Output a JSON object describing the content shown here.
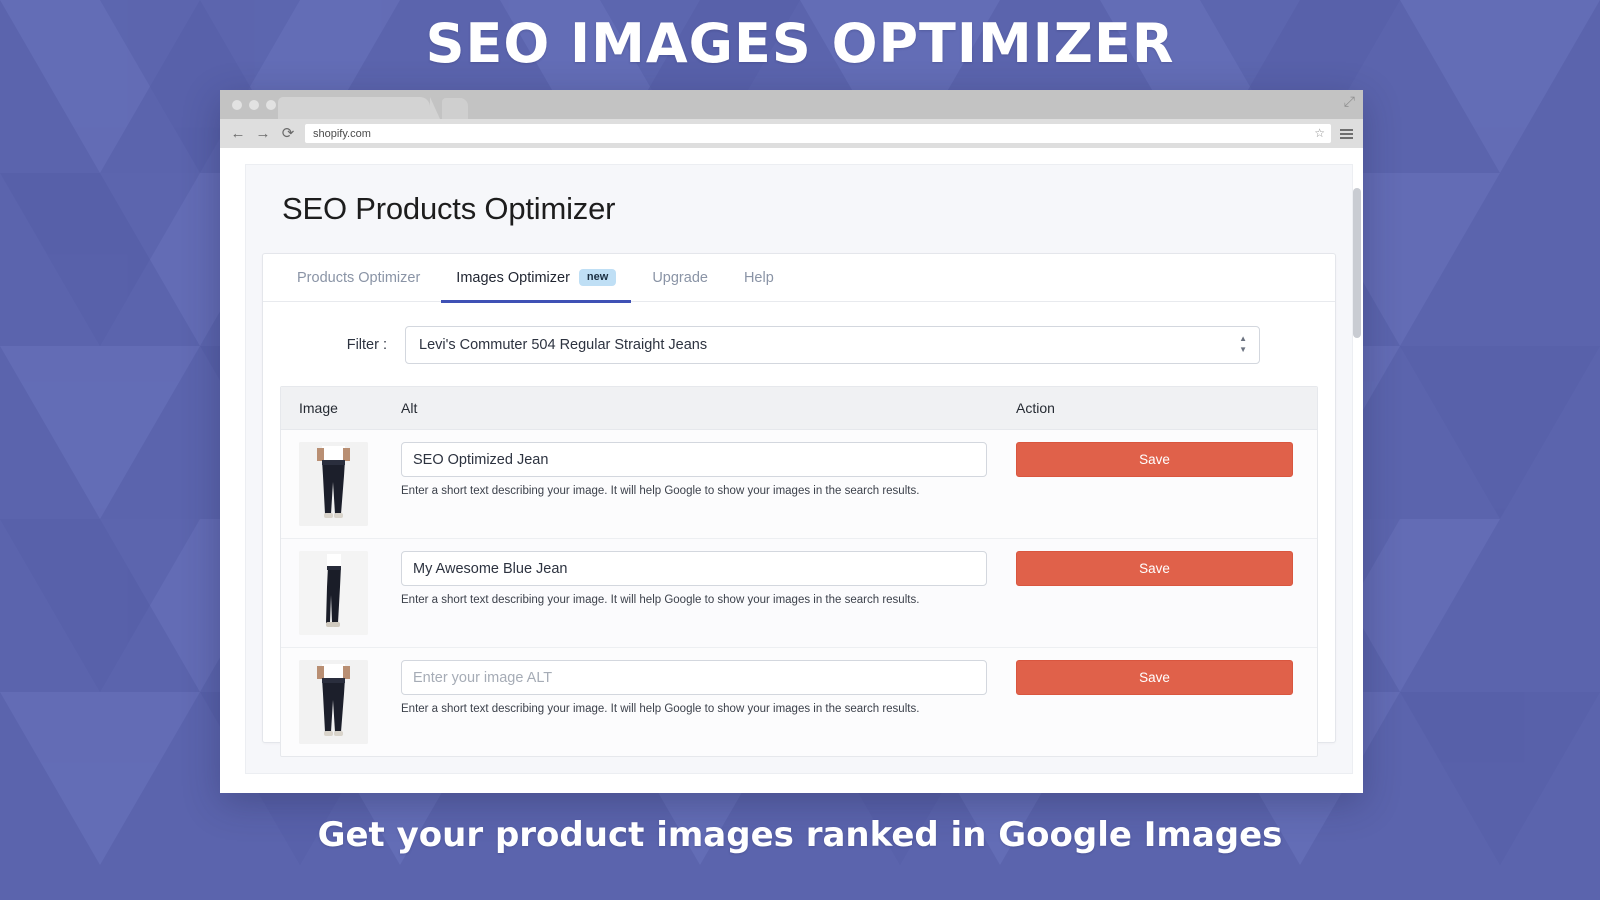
{
  "banner": {
    "headline": "SEO IMAGES OPTIMIZER",
    "footline": "Get your product images ranked in Google Images",
    "background_color": "#5b64ad",
    "background_accent": "#6a74bd"
  },
  "browser": {
    "back_icon": "←",
    "forward_icon": "→",
    "reload_icon": "⟳",
    "url": "shopify.com",
    "star_icon": "☆",
    "menu_icon": "hamburger-icon",
    "resize_icon": "⤢",
    "traffic_lights": [
      "close",
      "minimize",
      "maximize"
    ]
  },
  "app": {
    "title": "SEO Products Optimizer",
    "tabs": [
      {
        "label": "Products Optimizer",
        "active": false,
        "badge": null
      },
      {
        "label": "Images Optimizer",
        "active": true,
        "badge": "new"
      },
      {
        "label": "Upgrade",
        "active": false,
        "badge": null
      },
      {
        "label": "Help",
        "active": false,
        "badge": null
      }
    ],
    "filter": {
      "label": "Filter :",
      "value": "Levi's Commuter 504 Regular Straight Jeans",
      "stepper_up": "▲",
      "stepper_down": "▼"
    },
    "table": {
      "headers": {
        "image": "Image",
        "alt": "Alt",
        "action": "Action"
      },
      "helper_text": "Enter a short text describing your image. It will help Google to show your images in the search results.",
      "save_label": "Save",
      "save_color": "#e0614a",
      "alt_placeholder": "Enter your image ALT",
      "rows": [
        {
          "alt_value": "SEO Optimized Jean",
          "alt_placeholder": "Enter your image ALT",
          "helper": "Enter a short text describing your image. It will help Google to show your images in the search results.",
          "action": "Save",
          "image_name": "dark-jeans-front-thumbnail"
        },
        {
          "alt_value": "My Awesome Blue Jean",
          "alt_placeholder": "Enter your image ALT",
          "helper": "Enter a short text describing your image. It will help Google to show your images in the search results.",
          "action": "Save",
          "image_name": "dark-jeans-side-thumbnail"
        },
        {
          "alt_value": "",
          "alt_placeholder": "Enter your image ALT",
          "helper": "Enter a short text describing your image. It will help Google to show your images in the search results.",
          "action": "Save",
          "image_name": "dark-jeans-front-thumbnail-2"
        }
      ]
    }
  }
}
